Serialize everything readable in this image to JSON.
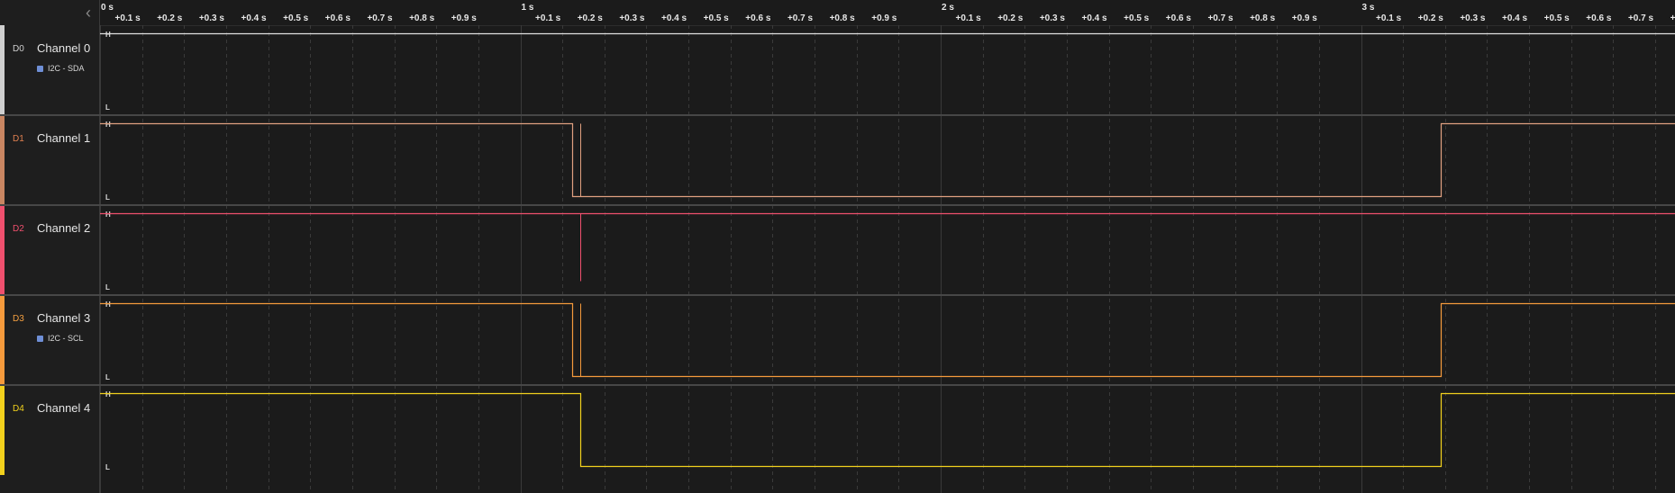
{
  "sidebar": {
    "collapse_icon": "chevron-left-icon",
    "channels": [
      {
        "id": "D0",
        "name": "Channel 0",
        "color": "#cfcfcf",
        "id_color": "#cfcfcf",
        "analyzer": "I2C - SDA"
      },
      {
        "id": "D1",
        "name": "Channel 1",
        "color": "#c98662",
        "id_color": "#e08050",
        "analyzer": null
      },
      {
        "id": "D2",
        "name": "Channel 2",
        "color": "#f0506e",
        "id_color": "#f0506e",
        "analyzer": null
      },
      {
        "id": "D3",
        "name": "Channel 3",
        "color": "#f59a3c",
        "id_color": "#f5a040",
        "analyzer": "I2C - SCL"
      },
      {
        "id": "D4",
        "name": "Channel 4",
        "color": "#f2d11d",
        "id_color": "#f2d11d",
        "analyzer": null
      }
    ]
  },
  "ruler": {
    "major": [
      "0 s",
      "1 s",
      "2 s",
      "3 s"
    ],
    "minor": [
      "+0.1 s",
      "+0.2 s",
      "+0.3 s",
      "+0.4 s",
      "+0.5 s",
      "+0.6 s",
      "+0.7 s",
      "+0.8 s",
      "+0.9 s"
    ]
  },
  "level_labels": {
    "high": "H",
    "low": "L"
  },
  "colors": {
    "trace_default": "#e0e0e0",
    "grid": "#3a3a3a",
    "analyzer_marker": "#6f8fd6"
  },
  "traces": [
    {
      "channel": "D0",
      "segments": [
        {
          "from_s": 0.0,
          "to_s": 3.72,
          "level": "H"
        }
      ]
    },
    {
      "channel": "D1",
      "edges_s": [
        1.124,
        1.143,
        3.19
      ],
      "initial": "H",
      "color": "#e0a080"
    },
    {
      "channel": "D2",
      "glitch_s": 1.143,
      "initial": "H",
      "color": "#f0506e"
    },
    {
      "channel": "D3",
      "edges_s": [
        1.124,
        1.143,
        3.19
      ],
      "initial": "H",
      "color": "#f59a3c"
    },
    {
      "channel": "D4",
      "edges_s": [
        1.143,
        3.19
      ],
      "initial": "H",
      "color": "#f2d11d"
    }
  ]
}
